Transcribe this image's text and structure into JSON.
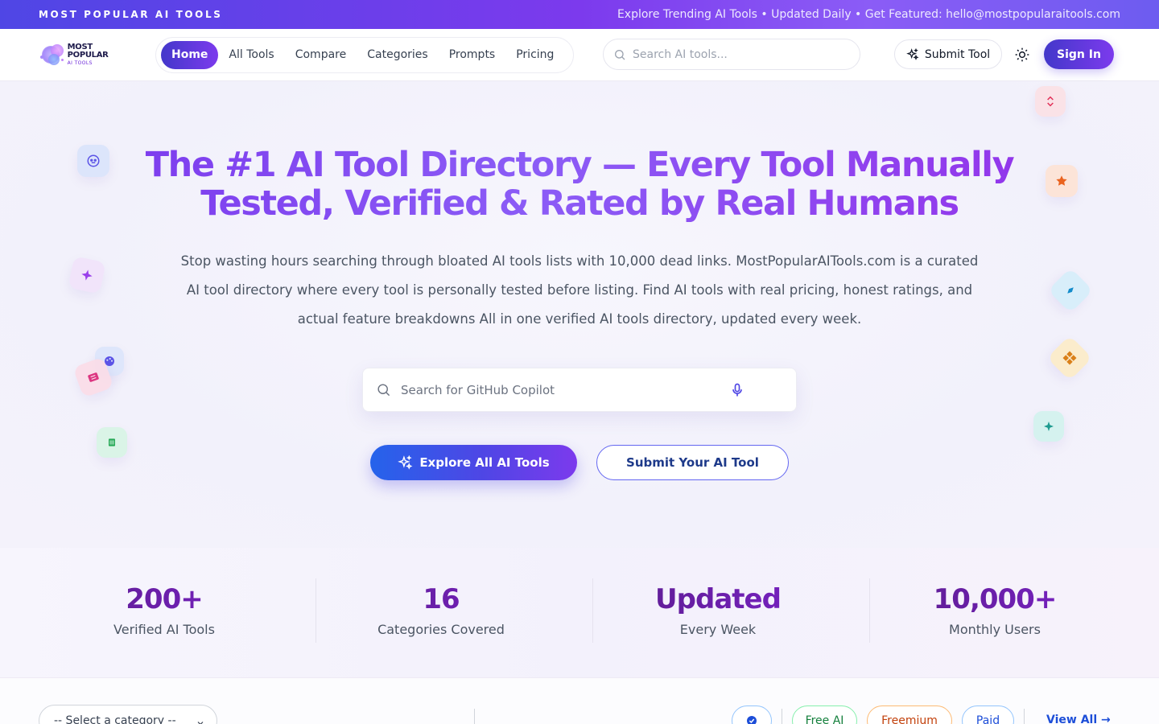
{
  "topbar": {
    "brand": "MOST POPULAR AI TOOLS",
    "announcement": "Explore Trending AI Tools • Updated Daily • Get Featured: hello@mostpopularaitools.com"
  },
  "logo": {
    "line1": "MOST POPULAR",
    "line2": "AI TOOLS"
  },
  "nav": {
    "items": [
      {
        "label": "Home",
        "active": true
      },
      {
        "label": "All Tools",
        "active": false
      },
      {
        "label": "Compare",
        "active": false
      },
      {
        "label": "Categories",
        "active": false
      },
      {
        "label": "Prompts",
        "active": false
      },
      {
        "label": "Pricing",
        "active": false
      }
    ],
    "search_placeholder": "Search AI tools...",
    "submit_tool_label": "Submit Tool",
    "sign_in_label": "Sign In"
  },
  "hero": {
    "title_line1": "The #1 AI Tool Directory — Every Tool Manually",
    "title_line2": "Tested, Verified & Rated by Real Humans",
    "subtitle": "Stop wasting hours searching through bloated AI tools lists with 10,000 dead links. MostPopularAITools.com is a curated AI tool directory where every tool is personally tested before listing. Find AI tools with real pricing, honest ratings, and actual feature breakdowns All in one verified AI tools directory, updated every week.",
    "search_placeholder": "Search for GitHub Copilot",
    "explore_label": "Explore All AI Tools",
    "submit_label": "Submit Your AI Tool"
  },
  "stats": [
    {
      "number": "200+",
      "label": "Verified AI Tools"
    },
    {
      "number": "16",
      "label": "Categories Covered"
    },
    {
      "number": "Updated",
      "label": "Every Week"
    },
    {
      "number": "10,000+",
      "label": "Monthly Users"
    }
  ],
  "filters": {
    "category_select": "-- Select a category --",
    "chips": [
      "Free AI",
      "Freemium",
      "Paid"
    ],
    "view_all": "View All →"
  },
  "colors": {
    "accent": "#7c3aed",
    "primary_blue": "#4338ca",
    "stat_purple": "#6b21a8",
    "free_green": "#15803d",
    "freemium_orange": "#c2410c",
    "paid_blue": "#1d4ed8"
  },
  "icons": [
    "search-icon",
    "sparkle-icon",
    "sun-icon",
    "microphone-icon",
    "chevron-down-icon",
    "check-badge-icon",
    "arrow-right-icon"
  ]
}
